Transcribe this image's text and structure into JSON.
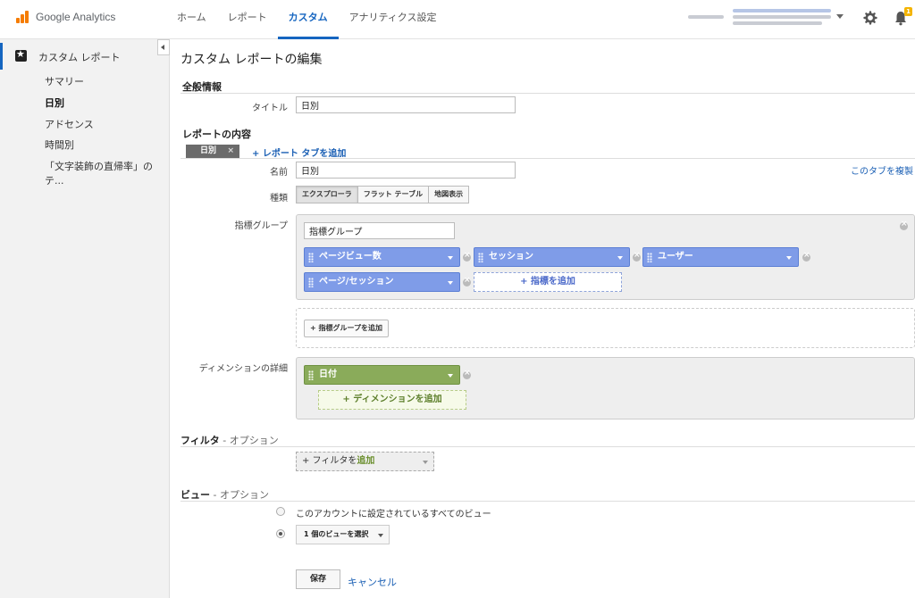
{
  "app": {
    "name": "Google Analytics"
  },
  "nav": [
    {
      "label": "ホーム"
    },
    {
      "label": "レポート"
    },
    {
      "label": "カスタム"
    },
    {
      "label": "アナリティクス設定"
    }
  ],
  "notifications": {
    "count": "1"
  },
  "sidebar": {
    "header": "カスタム レポート",
    "items": [
      {
        "label": "サマリー"
      },
      {
        "label": "日別"
      },
      {
        "label": "アドセンス"
      },
      {
        "label": "時間別"
      },
      {
        "label": "「文字装飾の直帰率」のテ..."
      }
    ]
  },
  "page": {
    "title": "カスタム レポートの編集"
  },
  "general": {
    "title": "全般情報",
    "title_label": "タイトル",
    "title_value": "日別"
  },
  "content": {
    "title": "レポートの内容",
    "tab_label": "日別",
    "tab_close": "×",
    "add_tab": "+ レポート タブを追加",
    "name_label": "名前",
    "name_value": "日別",
    "copy_tab": "このタブを複製",
    "type_label": "種類",
    "types": [
      {
        "label": "エクスプローラ"
      },
      {
        "label": "フラット テーブル"
      },
      {
        "label": "地図表示"
      }
    ],
    "metric_group_label": "指標グループ",
    "metric_group_name": "指標グループ",
    "metrics": [
      {
        "label": "ページビュー数"
      },
      {
        "label": "セッション"
      },
      {
        "label": "ユーザー"
      },
      {
        "label": "ページ/セッション"
      }
    ],
    "add_metric": "+ 指標を追加",
    "add_metric_group": "+ 指標グループを追加",
    "dimension_label": "ディメンションの詳細",
    "dimensions": [
      {
        "label": "日付"
      }
    ],
    "add_dimension": "+ ディメンションを追加"
  },
  "filter": {
    "title": "フィルタ",
    "optional": " - オプション",
    "add_prefix": "+ フィルタを",
    "add_word": "追加"
  },
  "view": {
    "title": "ビュー",
    "optional": " - オプション",
    "all_views": "このアカウントに設定されているすべてのビュー",
    "select_views": "1 個のビューを選択"
  },
  "actions": {
    "save": "保存",
    "cancel": "キャンセル"
  }
}
